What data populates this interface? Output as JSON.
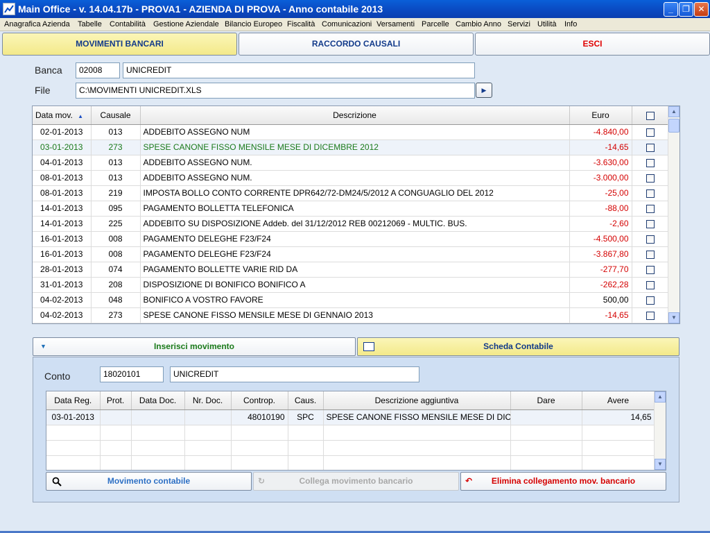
{
  "window": {
    "title": "Main Office - v. 14.04.17b - PROVA1 - AZIENDA DI PROVA - Anno contabile 2013",
    "minimize": "_",
    "maximize": "❐",
    "close": "✕"
  },
  "menu": [
    "Anagrafica Azienda",
    "Tabelle",
    "Contabilità",
    "Gestione Aziendale",
    "Bilancio Europeo",
    "Fiscalità",
    "Comunicazioni",
    "Versamenti",
    "Parcelle",
    "Cambio Anno",
    "Servizi",
    "Utilità",
    "Info"
  ],
  "tabs": {
    "movimenti": "MOVIMENTI BANCARI",
    "raccordo": "RACCORDO CAUSALI",
    "esci": "ESCI"
  },
  "colors": {
    "accent_yellow": "#f3e98a",
    "negative": "#d40000",
    "green": "#1a7a1a",
    "red_text": "#e00000",
    "blue_text": "#123a8a"
  },
  "banca": {
    "label": "Banca",
    "code": "02008",
    "name": "UNICREDIT"
  },
  "file": {
    "label": "File",
    "path": "C:\\MOVIMENTI UNICREDIT.XLS",
    "browse_icon": "right-arrow-icon"
  },
  "movements": {
    "headers": {
      "date": "Data mov.",
      "causale": "Causale",
      "descrizione": "Descrizione",
      "euro": "Euro"
    },
    "rows": [
      {
        "date": "02-01-2013",
        "causale": "013",
        "desc": "ADDEBITO ASSEGNO NUM",
        "euro": "-4.840,00"
      },
      {
        "date": "03-01-2013",
        "causale": "273",
        "desc": "SPESE CANONE FISSO MENSILE MESE DI DICEMBRE 2012",
        "euro": "-14,65"
      },
      {
        "date": "04-01-2013",
        "causale": "013",
        "desc": "ADDEBITO ASSEGNO NUM.",
        "euro": "-3.630,00"
      },
      {
        "date": "08-01-2013",
        "causale": "013",
        "desc": "ADDEBITO ASSEGNO NUM.",
        "euro": "-3.000,00"
      },
      {
        "date": "08-01-2013",
        "causale": "219",
        "desc": "IMPOSTA BOLLO CONTO CORRENTE DPR642/72-DM24/5/2012 A CONGUAGLIO DEL 2012",
        "euro": "-25,00"
      },
      {
        "date": "14-01-2013",
        "causale": "095",
        "desc": "PAGAMENTO BOLLETTA TELEFONICA",
        "euro": "-88,00"
      },
      {
        "date": "14-01-2013",
        "causale": "225",
        "desc": "ADDEBITO SU DISPOSIZIONE Addeb. del 31/12/2012 REB 00212069 - MULTIC. BUS.",
        "euro": "-2,60"
      },
      {
        "date": "16-01-2013",
        "causale": "008",
        "desc": "PAGAMENTO DELEGHE F23/F24",
        "euro": "-4.500,00"
      },
      {
        "date": "16-01-2013",
        "causale": "008",
        "desc": "PAGAMENTO DELEGHE F23/F24",
        "euro": "-3.867,80"
      },
      {
        "date": "28-01-2013",
        "causale": "074",
        "desc": "PAGAMENTO BOLLETTE VARIE RID DA",
        "euro": "-277,70"
      },
      {
        "date": "31-01-2013",
        "causale": "208",
        "desc": "DISPOSIZIONE DI BONIFICO BONIFICO A",
        "euro": "-262,28"
      },
      {
        "date": "04-02-2013",
        "causale": "048",
        "desc": "BONIFICO A VOSTRO FAVORE",
        "euro": "500,00"
      },
      {
        "date": "04-02-2013",
        "causale": "273",
        "desc": "SPESE CANONE FISSO MENSILE MESE DI GENNAIO 2013",
        "euro": "-14,65"
      }
    ]
  },
  "actions": {
    "inserisci": "Inserisci movimento",
    "scheda": "Scheda Contabile"
  },
  "conto": {
    "label": "Conto",
    "code": "18020101",
    "name": "UNICREDIT"
  },
  "entries": {
    "headers": {
      "data_reg": "Data Reg.",
      "prot": "Prot.",
      "data_doc": "Data Doc.",
      "nr_doc": "Nr. Doc.",
      "controp": "Controp.",
      "caus": "Caus.",
      "descr": "Descrizione aggiuntiva",
      "dare": "Dare",
      "avere": "Avere"
    },
    "rows": [
      {
        "data_reg": "03-01-2013",
        "prot": "",
        "data_doc": "",
        "nr_doc": "",
        "controp": "48010190",
        "caus": "SPC",
        "descr": "SPESE CANONE FISSO MENSILE MESE DI DICE",
        "dare": "",
        "avere": "14,65"
      }
    ]
  },
  "bottom_buttons": {
    "movimento": "Movimento contabile",
    "collega": "Collega movimento bancario",
    "elimina": "Elimina collegamento mov. bancario"
  }
}
